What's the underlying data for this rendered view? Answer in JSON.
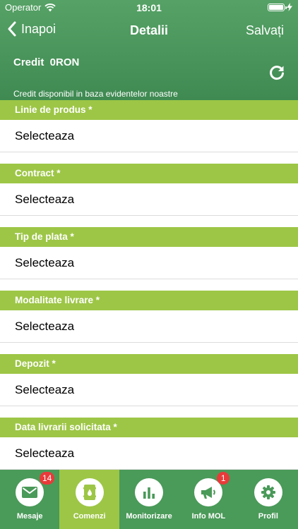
{
  "status": {
    "carrier": "Operator",
    "time": "18:01"
  },
  "nav": {
    "back_label": "Inapoi",
    "title": "Detalii",
    "save_label": "Salvați"
  },
  "credit": {
    "title": "Credit  0RON",
    "note": "Credit disponibil in baza evidentelor noastre"
  },
  "form": {
    "sections": [
      {
        "label": "Linie de produs *",
        "value": "Selecteaza"
      },
      {
        "label": "Contract *",
        "value": "Selecteaza"
      },
      {
        "label": "Tip de plata *",
        "value": "Selecteaza"
      },
      {
        "label": "Modalitate livrare *",
        "value": "Selecteaza"
      },
      {
        "label": "Depozit *",
        "value": "Selecteaza"
      },
      {
        "label": "Data livrarii solicitata *",
        "value": "Selecteaza"
      }
    ]
  },
  "tabs": [
    {
      "label": "Mesaje",
      "icon": "envelope-icon",
      "badge": "14",
      "active": false
    },
    {
      "label": "Comenzi",
      "icon": "barrel-icon",
      "active": true
    },
    {
      "label": "Monitorizare",
      "icon": "bar-chart-icon",
      "active": false
    },
    {
      "label": "Info MOL",
      "icon": "megaphone-icon",
      "badge": "1",
      "active": false
    },
    {
      "label": "Profil",
      "icon": "gear-icon",
      "active": false
    }
  ],
  "colors": {
    "header_green": "#4a9a59",
    "section_green": "#9dc646",
    "badge_red": "#e93a3a"
  }
}
